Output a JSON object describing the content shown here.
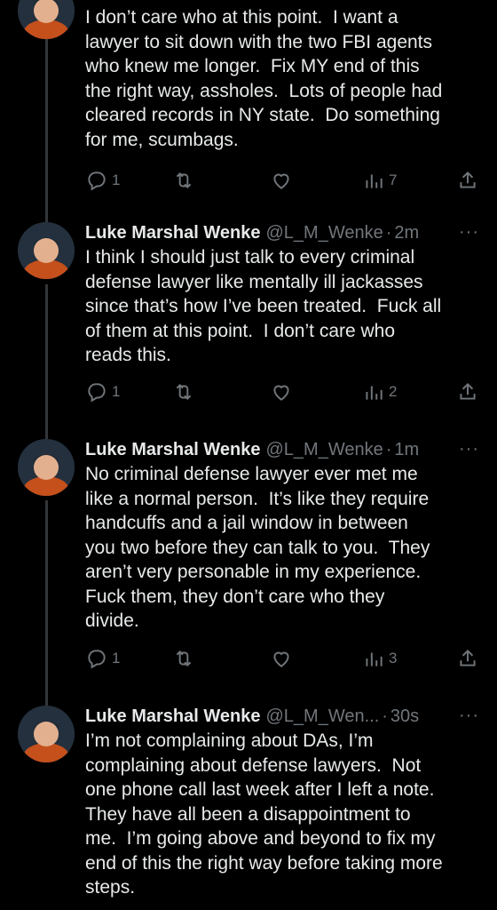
{
  "tweets": [
    {
      "name": "",
      "handle": "",
      "time": "",
      "text": "I don’t care who at this point.  I want a\nlawyer to sit down with the two FBI agents\nwho knew me longer.  Fix MY end of this\nthe right way, assholes.  Lots of people had\ncleared records in NY state.  Do something\nfor me, scumbags.",
      "replies": "1",
      "views": "7"
    },
    {
      "name": "Luke Marshal Wenke",
      "handle": "@L_M_Wenke",
      "time": "2m",
      "text": "I think I should just talk to every criminal\ndefense lawyer like mentally ill jackasses\nsince that’s how I’ve been treated.  Fuck all\nof them at this point.  I don’t care who\nreads this.",
      "replies": "1",
      "views": "2"
    },
    {
      "name": "Luke Marshal Wenke",
      "handle": "@L_M_Wenke",
      "time": "1m",
      "text": "No criminal defense lawyer ever met me\nlike a normal person.  It’s like they require\nhandcuffs and a jail window in between\nyou two before they can talk to you.  They\naren’t very personable in my experience.\nFuck them, they don’t care who they\ndivide.",
      "replies": "1",
      "views": "3"
    },
    {
      "name": "Luke Marshal Wenke",
      "handle": "@L_M_Wen...",
      "time": "30s",
      "text": "I’m not complaining about DAs, I’m\ncomplaining about defense lawyers.  Not\none phone call last week after I left a note.\nThey have all been a disappointment to\nme.  I’m going above and beyond to fix my\nend of this the right way before taking more\nsteps.",
      "replies": "",
      "views": ""
    }
  ],
  "separator": "·",
  "more_glyph": "···",
  "colors": {
    "background": "#000000",
    "text": "#e7e9ea",
    "muted": "#71767b"
  },
  "icons": [
    "reply-icon",
    "retweet-icon",
    "like-icon",
    "views-icon",
    "share-icon",
    "more-icon"
  ]
}
